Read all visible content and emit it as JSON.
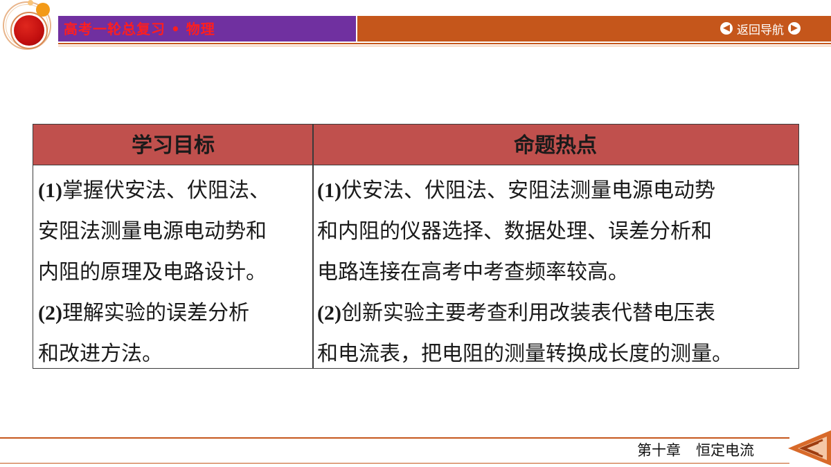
{
  "header": {
    "title": "高考一轮总复习 • 物理",
    "nav_label": "返回导航"
  },
  "table": {
    "headers": [
      "学习目标",
      "命题热点"
    ],
    "col1_lines": [
      {
        "num": "(1)",
        "text": "掌握伏安法、伏阻法、"
      },
      {
        "num": "",
        "text": "安阻法测量电源电动势和"
      },
      {
        "num": "",
        "text": "内阻的原理及电路设计。"
      },
      {
        "num": "(2)",
        "text": "理解实验的误差分析"
      },
      {
        "num": "",
        "text": "和改进方法。"
      }
    ],
    "col2_lines": [
      {
        "num": "(1)",
        "text": "伏安法、伏阻法、安阻法测量电源电动势"
      },
      {
        "num": "",
        "text": "和内阻的仪器选择、数据处理、误差分析和"
      },
      {
        "num": "",
        "text": "电路连接在高考中考查频率较高。"
      },
      {
        "num": "(2)",
        "text": "创新实验主要考查利用改装表代替电压表"
      },
      {
        "num": "",
        "text": "和电流表，把电阻的测量转换成长度的测量。"
      }
    ]
  },
  "footer": {
    "chapter": "第十章",
    "chapter_title": "恒定电流"
  },
  "colors": {
    "title_bar": "#7030a0",
    "nav_bar": "#c5561b",
    "title_text": "#ff1e1e",
    "table_header": "#c0504d",
    "logo_red": "#c20f0f",
    "logo_orange": "#f39a18"
  },
  "icons": [
    "logo-circle-icon",
    "arrow-left-icon",
    "arrow-right-icon",
    "back-arrow-icon"
  ]
}
